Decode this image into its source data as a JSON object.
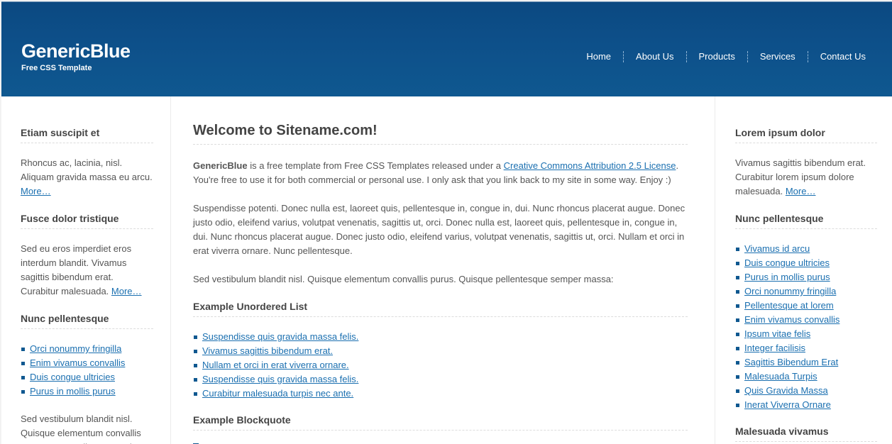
{
  "header": {
    "site_name": "GenericBlue",
    "tagline": "Free CSS Template",
    "nav": [
      "Home",
      "About Us",
      "Products",
      "Services",
      "Contact Us"
    ]
  },
  "left": {
    "s1": {
      "title": "Etiam suscipit et",
      "text": "Rhoncus ac, lacinia, nisl. Aliquam gravida massa eu arcu.",
      "more": "More…"
    },
    "s2": {
      "title": "Fusce dolor tristique",
      "text": "Sed eu eros imperdiet eros interdum blandit. Vivamus sagittis bibendum erat. Curabitur malesuada.",
      "more": "More…"
    },
    "s3": {
      "title": "Nunc pellentesque",
      "links": [
        "Orci nonummy fringilla",
        "Enim vivamus convallis",
        "Duis congue ultricies",
        "Purus in mollis purus"
      ]
    },
    "s4": {
      "text": "Sed vestibulum blandit nisl. Quisque elementum convallis purus. Suspendisse potenti."
    }
  },
  "main": {
    "title": "Welcome to Sitename.com!",
    "intro_strong": "GenericBlue",
    "intro_a": " is a free template from Free CSS Templates released under a ",
    "intro_link": "Creative Commons Attribution 2.5 License",
    "intro_b": ". You're free to use it for both commercial or personal use. I only ask that you link back to my site in some way. Enjoy :)",
    "para2": "Suspendisse potenti. Donec nulla est, laoreet quis, pellentesque in, congue in, dui. Nunc rhoncus placerat augue. Donec justo odio, eleifend varius, volutpat venenatis, sagittis ut, orci. Donec nulla est, laoreet quis, pellentesque in, congue in, dui. Nunc rhoncus placerat augue. Donec justo odio, eleifend varius, volutpat venenatis, sagittis ut, orci. Nullam et orci in erat viverra ornare. Nunc pellentesque.",
    "para3": "Sed vestibulum blandit nisl. Quisque elementum convallis purus. Quisque pellentesque semper massa:",
    "ul_title": "Example Unordered List",
    "ul_items": [
      "Suspendisse quis gravida massa felis.",
      "Vivamus sagittis bibendum erat.",
      "Nullam et orci in erat viverra ornare.",
      "Suspendisse quis gravida massa felis.",
      "Curabitur malesuada turpis nec ante."
    ],
    "bq_title": "Example Blockquote"
  },
  "right": {
    "s1": {
      "title": "Lorem ipsum dolor",
      "text": "Vivamus sagittis bibendum erat. Curabitur lorem ipsum dolore malesuada.",
      "more": "More…"
    },
    "s2": {
      "title": "Nunc pellentesque",
      "links": [
        "Vivamus id arcu",
        "Duis congue ultricies",
        "Purus in mollis purus",
        "Orci nonummy fringilla",
        "Pellentesque at lorem",
        "Enim vivamus convallis",
        "Ipsum vitae felis",
        "Integer facilisis",
        "Sagittis Bibendum Erat",
        "Malesuada Turpis",
        "Quis Gravida Massa",
        "Inerat Viverra Ornare"
      ]
    },
    "s3": {
      "title": "Malesuada vivamus"
    }
  },
  "colors": {
    "header_blue": "#0d4f89",
    "link_blue": "#1a6fb0",
    "bullet_blue": "#0f5890"
  }
}
